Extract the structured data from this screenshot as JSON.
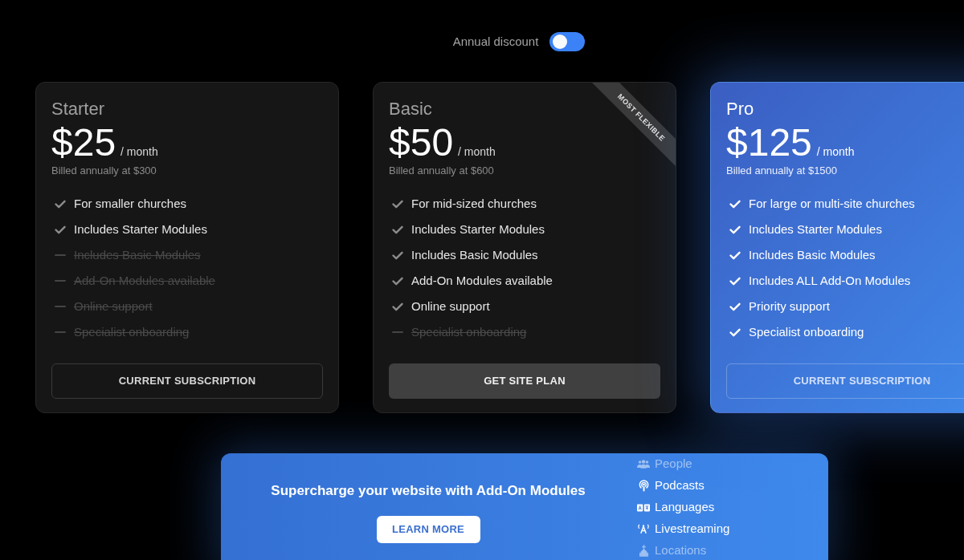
{
  "billing_toggle": {
    "label": "Annual discount",
    "on": false
  },
  "plans": [
    {
      "name": "Starter",
      "price": "$25",
      "period": "/ month",
      "billing_note": "Billed annually at $300",
      "featured": false,
      "features": [
        {
          "text": "For smaller churches",
          "included": true
        },
        {
          "text": "Includes Starter Modules",
          "included": true
        },
        {
          "text": "Includes Basic Modules",
          "included": false
        },
        {
          "text": "Add-On Modules available",
          "included": false
        },
        {
          "text": "Online support",
          "included": false
        },
        {
          "text": "Specialist onboarding",
          "included": false
        }
      ],
      "button": {
        "label": "CURRENT SUBSCRIPTION",
        "kind": "outline"
      }
    },
    {
      "name": "Basic",
      "price": "$50",
      "period": "/ month",
      "billing_note": "Billed annually at $600",
      "featured": false,
      "ribbon": "MOST FLEXIBLE",
      "features": [
        {
          "text": "For mid-sized churches",
          "included": true
        },
        {
          "text": "Includes Starter Modules",
          "included": true
        },
        {
          "text": "Includes Basic Modules",
          "included": true
        },
        {
          "text": "Add-On Modules available",
          "included": true
        },
        {
          "text": "Online support",
          "included": true
        },
        {
          "text": "Specialist onboarding",
          "included": false
        }
      ],
      "button": {
        "label": "GET SITE PLAN",
        "kind": "filled"
      }
    },
    {
      "name": "Pro",
      "price": "$125",
      "period": "/ month",
      "billing_note": "Billed annually at $1500",
      "featured": true,
      "features": [
        {
          "text": "For large or multi-site churches",
          "included": true
        },
        {
          "text": "Includes Starter Modules",
          "included": true
        },
        {
          "text": "Includes Basic Modules",
          "included": true
        },
        {
          "text": "Includes ALL Add-On Modules",
          "included": true
        },
        {
          "text": "Priority support",
          "included": true
        },
        {
          "text": "Specialist onboarding",
          "included": true
        }
      ],
      "button": {
        "label": "CURRENT SUBSCRIPTION",
        "kind": "outline"
      }
    }
  ],
  "addon_banner": {
    "heading": "Supercharge your website with Add-On Modules",
    "button": "LEARN MORE",
    "modules": [
      {
        "name": "People",
        "kind": "people",
        "dimmed": true
      },
      {
        "name": "Podcasts",
        "kind": "podcasts",
        "dimmed": false
      },
      {
        "name": "Languages",
        "kind": "languages",
        "dimmed": false
      },
      {
        "name": "Livestreaming",
        "kind": "livestreaming",
        "dimmed": false
      },
      {
        "name": "Locations",
        "kind": "locations",
        "dimmed": true
      }
    ]
  }
}
